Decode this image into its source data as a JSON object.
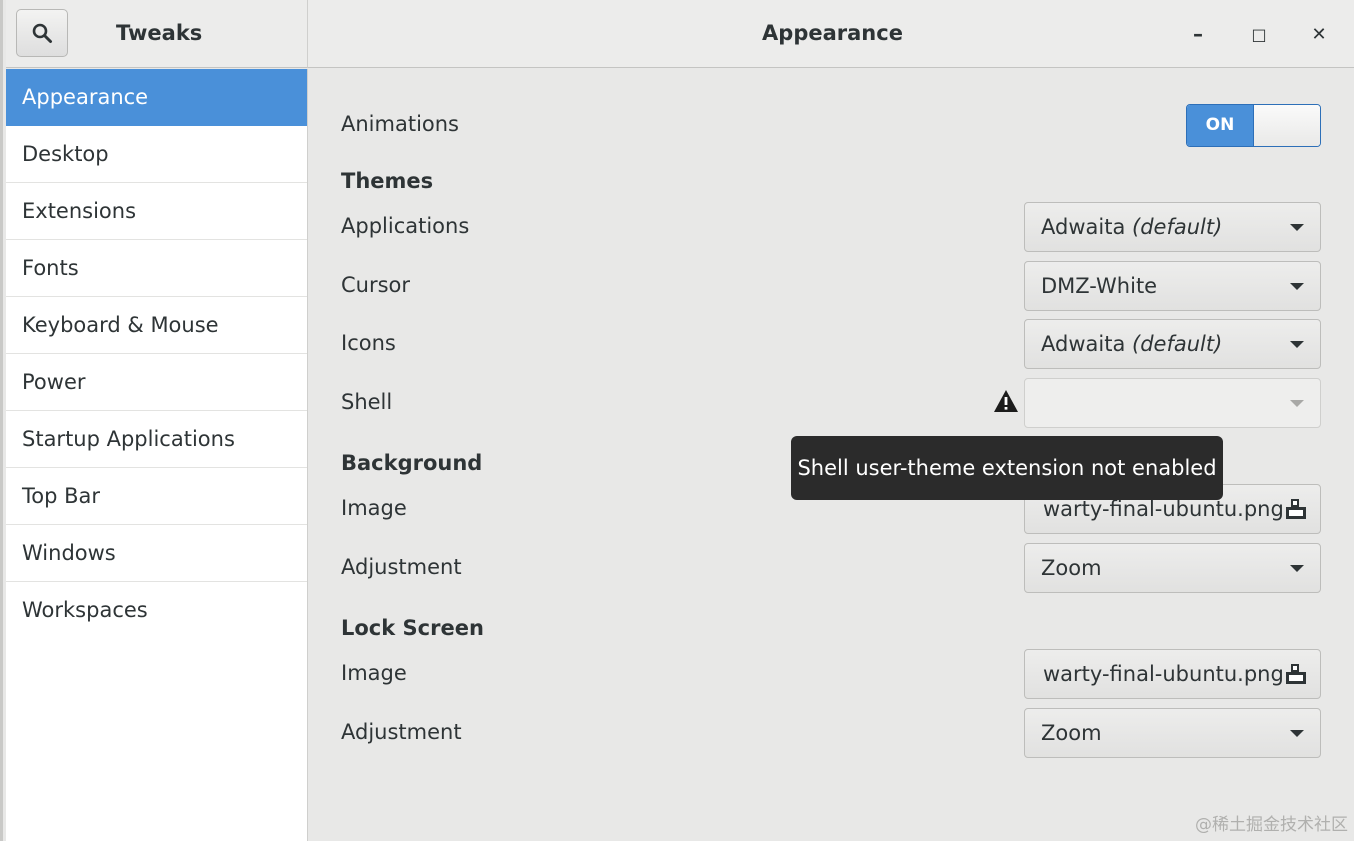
{
  "header": {
    "app_title": "Tweaks",
    "page_title": "Appearance",
    "minimize": "–",
    "maximize": "□",
    "close": "✕"
  },
  "sidebar": {
    "items": [
      {
        "label": "Appearance",
        "selected": true
      },
      {
        "label": "Desktop"
      },
      {
        "label": "Extensions"
      },
      {
        "label": "Fonts"
      },
      {
        "label": "Keyboard & Mouse"
      },
      {
        "label": "Power"
      },
      {
        "label": "Startup Applications"
      },
      {
        "label": "Top Bar"
      },
      {
        "label": "Windows"
      },
      {
        "label": "Workspaces"
      }
    ]
  },
  "main": {
    "animations": {
      "label": "Animations",
      "switch_text": "ON",
      "state": true
    },
    "themes": {
      "title": "Themes",
      "applications": {
        "label": "Applications",
        "value": "Adwaita",
        "suffix": "(default)"
      },
      "cursor": {
        "label": "Cursor",
        "value": "DMZ-White"
      },
      "icons": {
        "label": "Icons",
        "value": "Adwaita",
        "suffix": "(default)"
      },
      "shell": {
        "label": "Shell",
        "value": ""
      }
    },
    "tooltip": "Shell user-theme extension not enabled",
    "background": {
      "title": "Background",
      "image": {
        "label": "Image",
        "value": "warty-final-ubuntu.png"
      },
      "adjustment": {
        "label": "Adjustment",
        "value": "Zoom"
      }
    },
    "lock_screen": {
      "title": "Lock Screen",
      "image": {
        "label": "Image",
        "value": "warty-final-ubuntu.png"
      },
      "adjustment": {
        "label": "Adjustment",
        "value": "Zoom"
      }
    }
  },
  "watermark": "@稀土掘金技术社区",
  "colors": {
    "accent": "#4a90d9",
    "tooltip_bg": "#2b2b2b"
  }
}
